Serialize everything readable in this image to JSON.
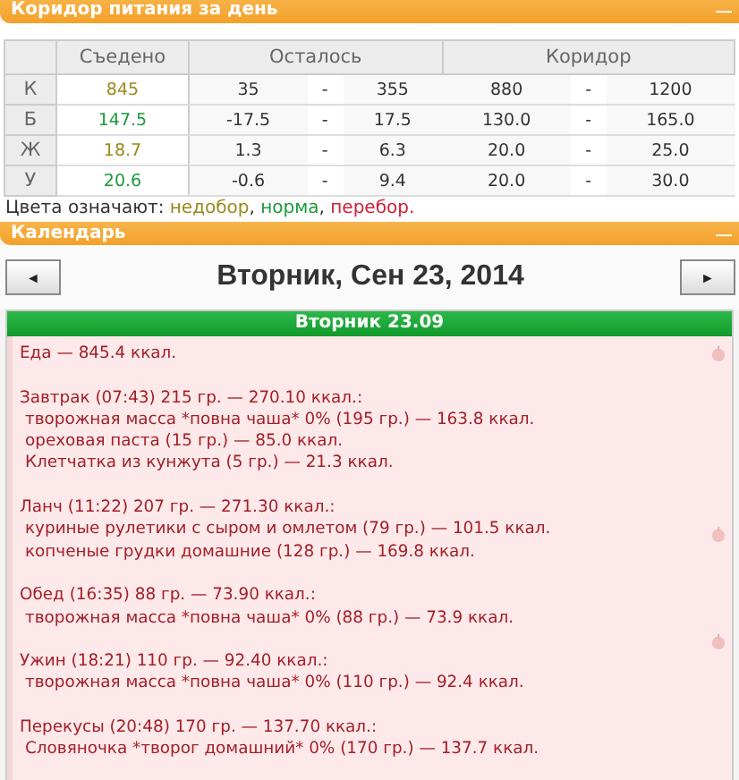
{
  "corridor_panel": {
    "title": "Коридор питания за день",
    "collapse": "—",
    "columns": [
      "Съедено",
      "Осталось",
      "Коридор"
    ],
    "rows": [
      {
        "label": "К",
        "eaten": "845",
        "color": "#9a8a1e",
        "left_min": "35",
        "left_sep": "-",
        "left_max": "355",
        "range_min": "880",
        "range_sep": "-",
        "range_max": "1200"
      },
      {
        "label": "Б",
        "eaten": "147.5",
        "color": "#1a9a3a",
        "left_min": "-17.5",
        "left_sep": "-",
        "left_max": "17.5",
        "range_min": "130.0",
        "range_sep": "-",
        "range_max": "165.0"
      },
      {
        "label": "Ж",
        "eaten": "18.7",
        "color": "#9a8a1e",
        "left_min": "1.3",
        "left_sep": "-",
        "left_max": "6.3",
        "range_min": "20.0",
        "range_sep": "-",
        "range_max": "25.0"
      },
      {
        "label": "У",
        "eaten": "20.6",
        "color": "#1a9a3a",
        "left_min": "-0.6",
        "left_sep": "-",
        "left_max": "9.4",
        "range_min": "20.0",
        "range_sep": "-",
        "range_max": "30.0"
      }
    ],
    "legend": [
      {
        "text": "Цвета означают: ",
        "color": "#333333"
      },
      {
        "text": "недобор",
        "color": "#9a8a1e"
      },
      {
        "text": ", ",
        "color": "#333333"
      },
      {
        "text": "норма",
        "color": "#1a9a3a"
      },
      {
        "text": ", ",
        "color": "#333333"
      },
      {
        "text": "перебор.",
        "color": "#d0203a"
      }
    ]
  },
  "calendar_panel": {
    "title": "Календарь",
    "collapse": "—",
    "prev": "◄",
    "next": "►",
    "date": "Вторник, Сен 23, 2014",
    "day_header": "Вторник 23.09",
    "total": "Еда — 845.4 ккал.",
    "meals": [
      {
        "title": "Завтрак (07:43) 215 гр. — 270.10 ккал.:",
        "items": [
          "творожная масса *повна чаша* 0% (195 гр.) — 163.8 ккал.",
          "ореховая паста (15 гр.) — 85.0 ккал.",
          "Клетчатка из кунжута (5 гр.) — 21.3 ккал."
        ]
      },
      {
        "title": "Ланч (11:22) 207 гр. — 271.30 ккал.:",
        "items": [
          "куриные рулетики с сыром и омлетом (79 гр.) — 101.5 ккал.",
          "копченые грудки домашние (128 гр.) — 169.8 ккал."
        ]
      },
      {
        "title": "Обед (16:35) 88 гр. — 73.90 ккал.:",
        "items": [
          "творожная масса *повна чаша* 0% (88 гр.) — 73.9 ккал."
        ]
      },
      {
        "title": "Ужин (18:21) 110 гр. — 92.40 ккал.:",
        "items": [
          "творожная масса *повна чаша* 0% (110 гр.) — 92.4 ккал."
        ]
      },
      {
        "title": "Перекусы (20:48) 170 гр. — 137.70 ккал.:",
        "items": [
          "Словяночка *творог домашний* 0% (170 гр.) — 137.7 ккал."
        ]
      }
    ]
  }
}
